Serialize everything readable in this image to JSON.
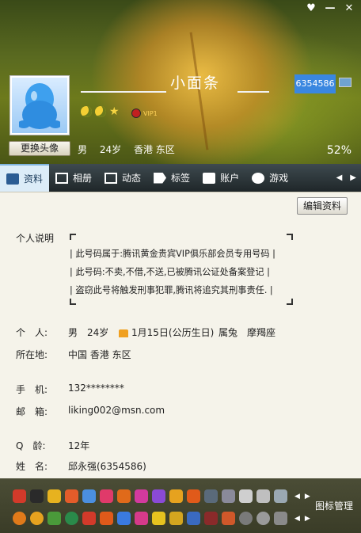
{
  "window": {
    "skin_label": "♥",
    "minimize_label": "—",
    "close_label": "✕"
  },
  "profile": {
    "nickname": "小面条",
    "qq_number": "6354586",
    "change_avatar_label": "更换头像",
    "gender": "男",
    "age": "24岁",
    "location": "香港 东区",
    "completion": "52%",
    "vip_label": "VIP1"
  },
  "tabs": [
    {
      "label": "资料"
    },
    {
      "label": "相册"
    },
    {
      "label": "动态"
    },
    {
      "label": "标签"
    },
    {
      "label": "账户"
    },
    {
      "label": "游戏"
    }
  ],
  "main": {
    "edit_label": "编辑资料",
    "desc_label": "个人说明",
    "desc_lines": [
      "| 此号码属于:腾讯黄金贵宾VIP俱乐部会员专用号码 |",
      "| 此号码:不卖,不借,不送,已被腾讯公证处备案登记  |",
      "| 盗窃此号将触发刑事犯罪,腾讯将追究其刑事责任. |"
    ],
    "personal_label": "个　人:",
    "personal_gender": "男",
    "personal_age": "24岁",
    "birthday": "1月15日(公历生日)",
    "zodiac": "属兔",
    "constellation": "摩羯座",
    "location_label": "所在地:",
    "location_value": "中国 香港 东区",
    "phone_label": "手　机:",
    "phone_value": "132********",
    "email_label": "邮　箱:",
    "email_value": "liking002@msn.com",
    "qage_label": "Q　龄:",
    "qage_value": "12年",
    "name_label": "姓　名:",
    "name_value": "邱永强(6354586)"
  },
  "footer": {
    "manage_label": "图标管理"
  }
}
